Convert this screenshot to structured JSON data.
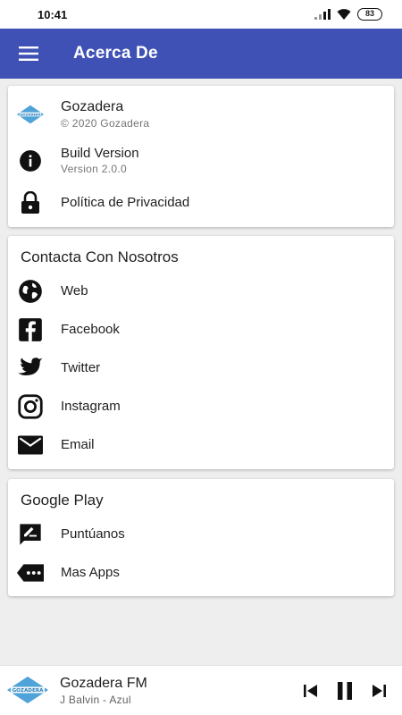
{
  "status_bar": {
    "time": "10:41",
    "battery": "83"
  },
  "app_bar": {
    "title": "Acerca De",
    "color": "#3f51b5"
  },
  "about": {
    "app_name": "Gozadera",
    "copyright": "© 2020 Gozadera",
    "build_label": "Build Version",
    "build_value": "Version 2.0.0",
    "privacy_label": "Política de Privacidad"
  },
  "contact": {
    "title": "Contacta Con Nosotros",
    "items": [
      {
        "label": "Web",
        "icon": "globe-icon"
      },
      {
        "label": "Facebook",
        "icon": "facebook-icon"
      },
      {
        "label": "Twitter",
        "icon": "twitter-icon"
      },
      {
        "label": "Instagram",
        "icon": "instagram-icon"
      },
      {
        "label": "Email",
        "icon": "email-icon"
      }
    ]
  },
  "google_play": {
    "title": "Google Play",
    "items": [
      {
        "label": "Puntúanos",
        "icon": "rate-review-icon"
      },
      {
        "label": "Mas Apps",
        "icon": "more-apps-icon"
      }
    ]
  },
  "player": {
    "station": "Gozadera FM",
    "track": "J Balvin - Azul",
    "logo_text": "GOZADERA",
    "logo_color": "#4fa3d8"
  }
}
